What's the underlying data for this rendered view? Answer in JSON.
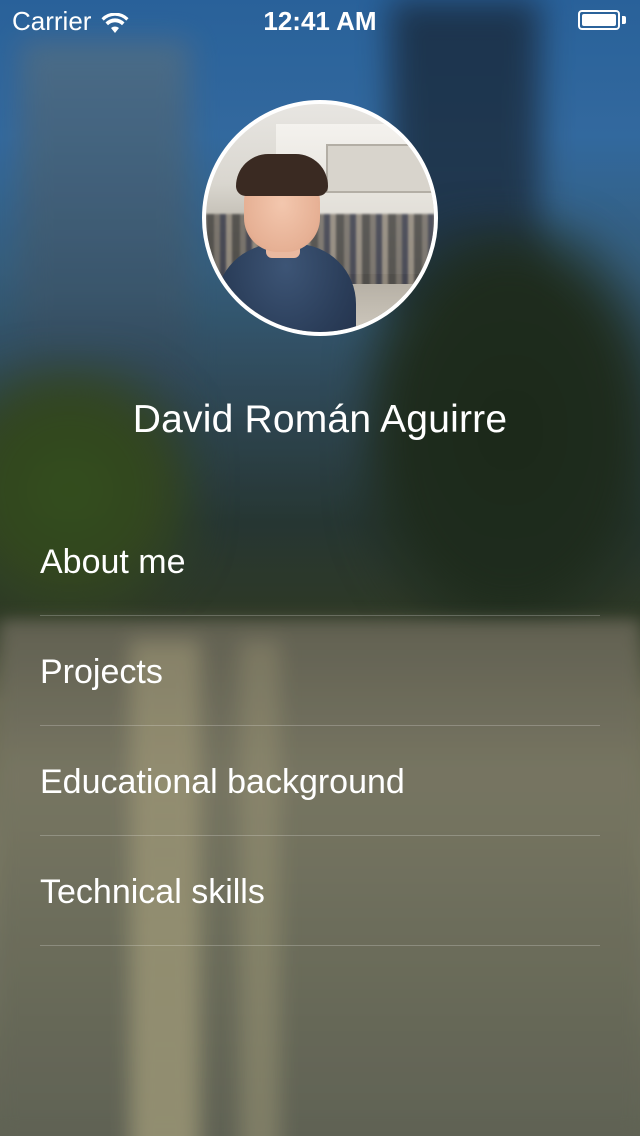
{
  "status_bar": {
    "carrier": "Carrier",
    "time": "12:41 AM",
    "wifi_icon": "wifi-icon",
    "battery_icon": "battery-full-icon"
  },
  "profile": {
    "name": "David Román Aguirre"
  },
  "menu": {
    "items": [
      {
        "label": "About me"
      },
      {
        "label": "Projects"
      },
      {
        "label": "Educational background"
      },
      {
        "label": "Technical skills"
      }
    ]
  },
  "colors": {
    "text": "#ffffff",
    "separator": "rgba(255,255,255,0.22)"
  }
}
